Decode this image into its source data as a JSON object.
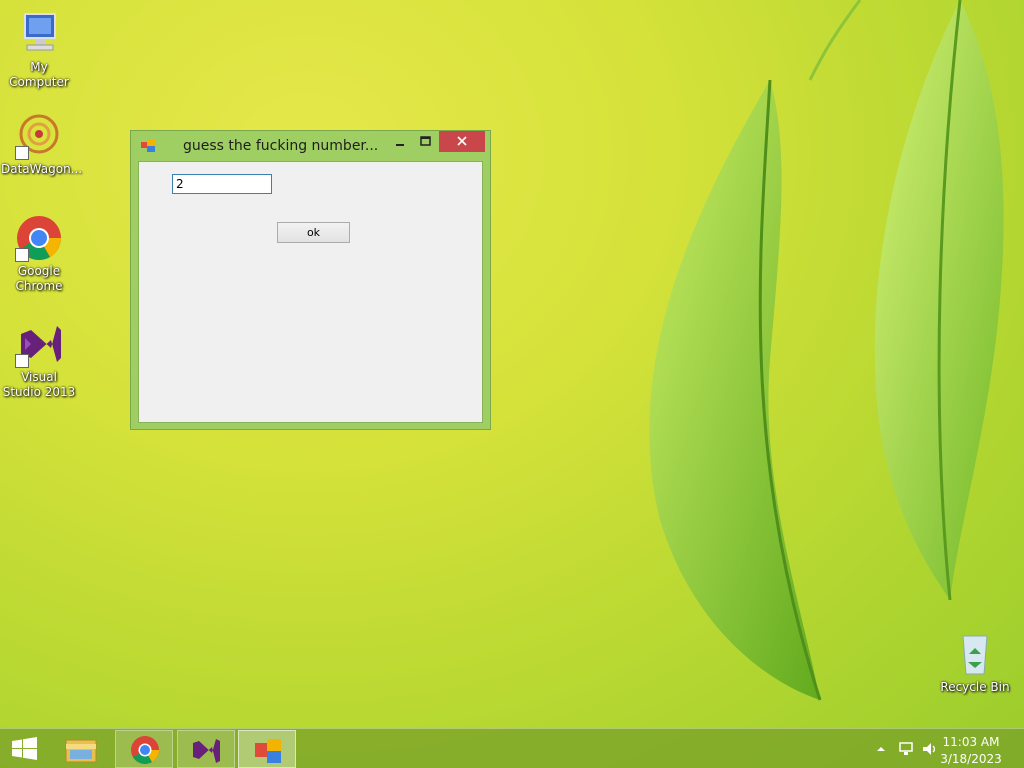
{
  "desktop": {
    "icons": [
      {
        "label": "My Computer",
        "icon": "computer-icon"
      },
      {
        "label": "DataWagon...",
        "icon": "datawagon-icon"
      },
      {
        "label": "Google Chrome",
        "icon": "chrome-icon"
      },
      {
        "label": "Visual Studio 2013",
        "icon": "visual-studio-icon"
      },
      {
        "label": "Recycle Bin",
        "icon": "recycle-bin-icon"
      }
    ]
  },
  "window": {
    "title": "guess the fucking number...",
    "input_value": "2",
    "ok_label": "ok"
  },
  "taskbar": {
    "items": [
      "start-icon",
      "file-explorer-icon",
      "chrome-icon",
      "visual-studio-icon",
      "winforms-app-icon"
    ],
    "clock_time": "11:03 AM",
    "clock_date": "3/18/2023"
  },
  "colors": {
    "close_button": "#c9474a",
    "window_frame": "#9fcf62",
    "client_bg": "#f0f0f0",
    "input_border": "#3c7fb1"
  }
}
